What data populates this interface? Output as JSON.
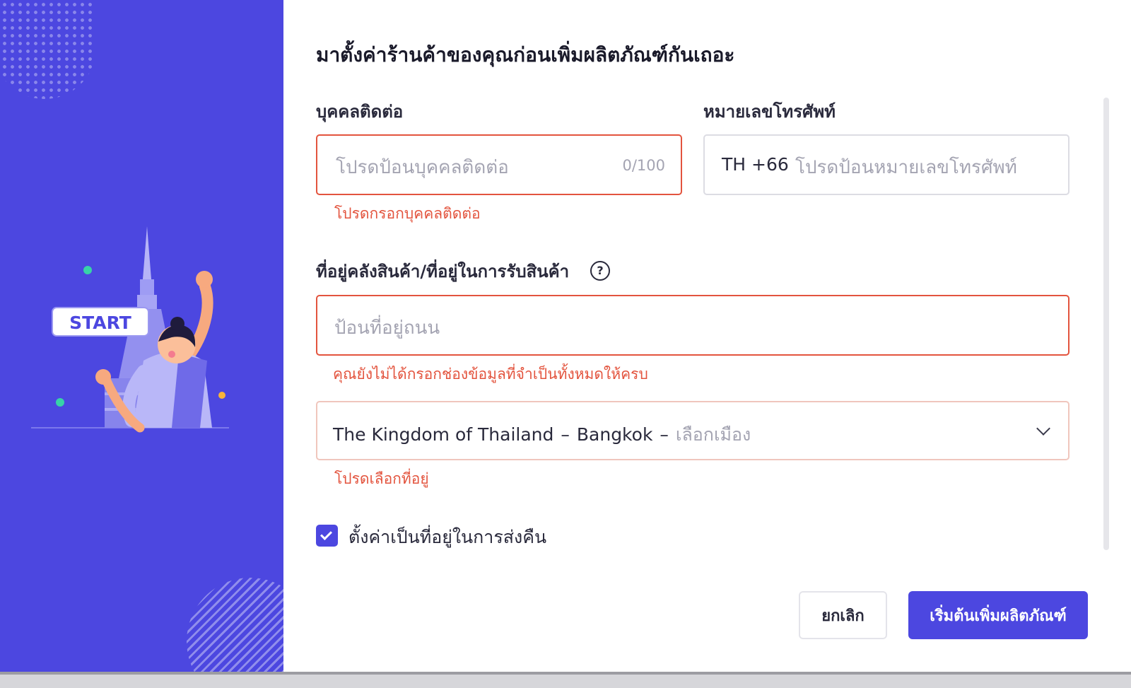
{
  "colors": {
    "brand": "#4c47e0",
    "error": "#e3543e",
    "text": "#1a1a2a",
    "placeholder": "#a4a4b2",
    "border": "#dcdce3"
  },
  "illustration": {
    "badge_text": "START"
  },
  "form": {
    "title": "มาตั้งค่าร้านค้าของคุณก่อนเพิ่มผลิตภัณฑ์กันเถอะ",
    "contact": {
      "label": "บุคคลติดต่อ",
      "placeholder": "โปรดป้อนบุคคลติดต่อ",
      "counter": "0/100",
      "error": "โปรดกรอกบุคคลติดต่อ"
    },
    "phone": {
      "label": "หมายเลขโทรศัพท์",
      "prefix": "TH +66",
      "placeholder": "โปรดป้อนหมายเลขโทรศัพท์"
    },
    "address": {
      "label": "ที่อยู่คลังสินค้า/ที่อยู่ในการรับสินค้า",
      "help_icon": "question-circle",
      "help_symbol": "?",
      "street_placeholder": "ป้อนที่อยู่ถนน",
      "street_error": "คุณยังไม่ได้กรอกช่องข้อมูลที่จำเป็นทั้งหมดให้ครบ",
      "region_value": "The Kingdom of Thailand",
      "region_separator": "–",
      "region_city": "Bangkok",
      "region_placeholder": "เลือกเมือง",
      "region_error": "โปรดเลือกที่อยู่"
    },
    "return_address": {
      "checked": true,
      "label": "ตั้งค่าเป็นที่อยู่ในการส่งคืน"
    },
    "buttons": {
      "cancel": "ยกเลิก",
      "submit": "เริ่มต้นเพิ่มผลิตภัณฑ์"
    }
  }
}
